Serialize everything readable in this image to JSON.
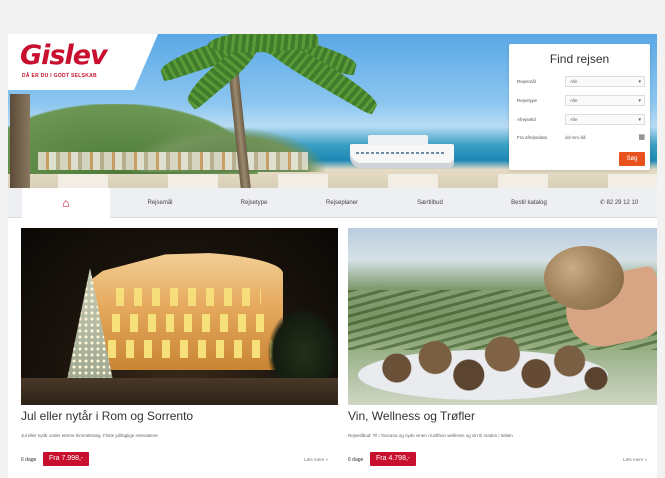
{
  "brand": {
    "name": "Gislev",
    "tagline": "DÅ ER DU I GODT SELSKAB",
    "colors": {
      "red": "#c8102e",
      "orange": "#e8531d"
    }
  },
  "search": {
    "title": "Find rejsen",
    "fields": [
      {
        "label": "Rejsemål",
        "value": "Alle"
      },
      {
        "label": "Rejsetype",
        "value": "Alle"
      },
      {
        "label": "Afrejsetid",
        "value": "Alle"
      }
    ],
    "date": {
      "label": "Fra afrejsedato",
      "value": "dd-mm-åå",
      "icon": "calendar-icon"
    },
    "button": "Søg"
  },
  "nav": {
    "home_icon": "home-icon",
    "items": [
      "Rejsemål",
      "Rejsetype",
      "Rejseplaner",
      "Særtilbud",
      "Bestil katalog"
    ],
    "phone_icon": "phone-icon",
    "phone": "82 29 12 10"
  },
  "cards": [
    {
      "title": "Jul eller nytår i Rom og Sorrento",
      "description": "Jul eller nytår under eterne himmelstrøg. Flotte julifaglige relevatierer",
      "days": "6 dage",
      "price": "Fra 7.998,-",
      "more": "Læs mere »"
    },
    {
      "title": "Vin, Wellness og Trøfler",
      "description": "Rejsetilbud: Til i Toscana og nyde vinen i lusfthon wellness og vin til maden i Italien",
      "days": "6 dage",
      "price": "Fra 4.798,-",
      "more": "Læs mere »"
    }
  ]
}
